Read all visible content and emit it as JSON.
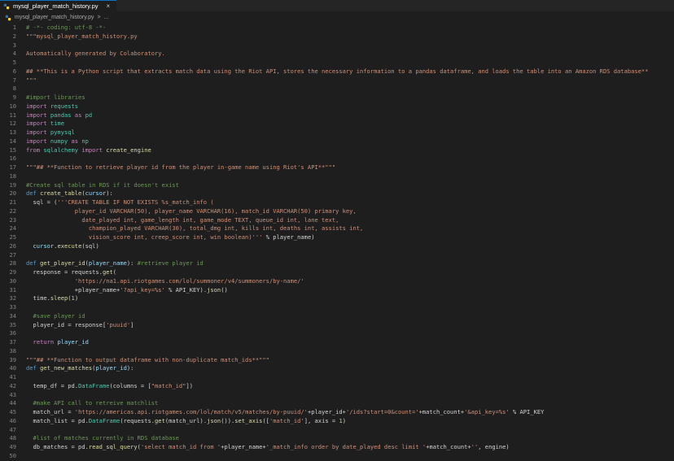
{
  "tab": {
    "title": "mysql_player_match_history.py",
    "close": "×"
  },
  "breadcrumb": {
    "file": "mysql_player_match_history.py",
    "sep": ">",
    "more": "..."
  },
  "colors": {
    "comment": "#6a9955",
    "string": "#ce9178",
    "keyword": "#c586c0",
    "def": "#569cd6",
    "func": "#dcdcaa",
    "var": "#9cdcfe",
    "number": "#b5cea8"
  },
  "lines": [
    {
      "n": "1",
      "t": [
        [
          "# -*- coding: utf-8 -*-",
          "comment"
        ]
      ]
    },
    {
      "n": "2",
      "t": [
        [
          "\"\"\"mysql_player_match_history.py",
          "string"
        ]
      ]
    },
    {
      "n": "3",
      "t": []
    },
    {
      "n": "4",
      "t": [
        [
          "Automatically generated by Colaboratory.",
          "string"
        ]
      ]
    },
    {
      "n": "5",
      "t": []
    },
    {
      "n": "6",
      "t": [
        [
          "## **This is a Python script that extracts match data using the Riot API, stores the necessary information to a pandas dataframe, and loads the table into an Amazon RDS database**",
          "string"
        ]
      ]
    },
    {
      "n": "7",
      "t": [
        [
          "\"\"\"",
          "string"
        ]
      ]
    },
    {
      "n": "8",
      "t": []
    },
    {
      "n": "9",
      "t": [
        [
          "#import libraries",
          "comment"
        ]
      ]
    },
    {
      "n": "10",
      "t": [
        [
          "import",
          "keyword"
        ],
        [
          " requests",
          "class"
        ]
      ]
    },
    {
      "n": "11",
      "t": [
        [
          "import",
          "keyword"
        ],
        [
          " pandas ",
          "class"
        ],
        [
          "as",
          "keyword"
        ],
        [
          " pd",
          "class"
        ]
      ]
    },
    {
      "n": "12",
      "t": [
        [
          "import",
          "keyword"
        ],
        [
          " time",
          "class"
        ]
      ]
    },
    {
      "n": "13",
      "t": [
        [
          "import",
          "keyword"
        ],
        [
          " pymysql",
          "class"
        ]
      ]
    },
    {
      "n": "14",
      "t": [
        [
          "import",
          "keyword"
        ],
        [
          " numpy ",
          "class"
        ],
        [
          "as",
          "keyword"
        ],
        [
          " np",
          "class"
        ]
      ]
    },
    {
      "n": "15",
      "t": [
        [
          "from",
          "keyword"
        ],
        [
          " sqlalchemy ",
          "class"
        ],
        [
          "import",
          "keyword"
        ],
        [
          " create_engine",
          "func"
        ]
      ]
    },
    {
      "n": "16",
      "t": []
    },
    {
      "n": "17",
      "t": [
        [
          "\"\"\"## **Function to retrieve player id from the player in-game name using Riot's API**\"\"\"",
          "string"
        ]
      ]
    },
    {
      "n": "18",
      "t": []
    },
    {
      "n": "19",
      "t": [
        [
          "#Create sql table in RDS if it doesn't exist",
          "comment"
        ]
      ]
    },
    {
      "n": "20",
      "t": [
        [
          "def",
          "def"
        ],
        [
          " create_table",
          "func"
        ],
        [
          "(",
          "plain"
        ],
        [
          "cursor",
          "var"
        ],
        [
          "):",
          "plain"
        ]
      ]
    },
    {
      "n": "21",
      "t": [
        [
          "  sql = (",
          "plain"
        ],
        [
          "'''CREATE TABLE IF NOT EXISTS %s_match_info (",
          "string"
        ]
      ]
    },
    {
      "n": "22",
      "t": [
        [
          "              player_id VARCHAR(50), player_name VARCHAR(16), match_id VARCHAR(50) primary key,",
          "string"
        ]
      ]
    },
    {
      "n": "23",
      "t": [
        [
          "                date_played int, game_length int, game_mode TEXT, queue_id int, lane text,",
          "string"
        ]
      ]
    },
    {
      "n": "24",
      "t": [
        [
          "                  champion_played VARCHAR(30), total_dmg int, kills int, deaths int, assists int,",
          "string"
        ]
      ]
    },
    {
      "n": "25",
      "t": [
        [
          "                  vision_score int, creep_score int, win boolean)'''",
          "string"
        ],
        [
          " % player_name)",
          "plain"
        ]
      ]
    },
    {
      "n": "26",
      "t": [
        [
          "  cursor",
          "var"
        ],
        [
          ".",
          "plain"
        ],
        [
          "execute",
          "func"
        ],
        [
          "(sql)",
          "plain"
        ]
      ]
    },
    {
      "n": "27",
      "t": []
    },
    {
      "n": "28",
      "t": [
        [
          "def",
          "def"
        ],
        [
          " get_player_id",
          "func"
        ],
        [
          "(",
          "plain"
        ],
        [
          "player_name",
          "var"
        ],
        [
          "): ",
          "plain"
        ],
        [
          "#retrieve player id",
          "comment"
        ]
      ]
    },
    {
      "n": "29",
      "t": [
        [
          "  response = requests.",
          "plain"
        ],
        [
          "get",
          "func"
        ],
        [
          "(",
          "plain"
        ]
      ]
    },
    {
      "n": "30",
      "t": [
        [
          "              'https://na1.api.riotgames.com/lol/summoner/v4/summoners/by-name/'",
          "string"
        ]
      ]
    },
    {
      "n": "31",
      "t": [
        [
          "              +player_name+",
          "plain"
        ],
        [
          "'?api_key=%s'",
          "string"
        ],
        [
          " % API_KEY).",
          "plain"
        ],
        [
          "json",
          "func"
        ],
        [
          "()",
          "plain"
        ]
      ]
    },
    {
      "n": "32",
      "t": [
        [
          "  time.",
          "plain"
        ],
        [
          "sleep",
          "func"
        ],
        [
          "(",
          "plain"
        ],
        [
          "1",
          "number"
        ],
        [
          ")",
          "plain"
        ]
      ]
    },
    {
      "n": "33",
      "t": []
    },
    {
      "n": "34",
      "t": [
        [
          "  #save player id",
          "comment"
        ]
      ]
    },
    {
      "n": "35",
      "t": [
        [
          "  player_id = response[",
          "plain"
        ],
        [
          "'puuid'",
          "string"
        ],
        [
          "]",
          "plain"
        ]
      ]
    },
    {
      "n": "36",
      "t": []
    },
    {
      "n": "37",
      "t": [
        [
          "  ",
          "plain"
        ],
        [
          "return",
          "keyword"
        ],
        [
          " player_id",
          "var"
        ]
      ]
    },
    {
      "n": "38",
      "t": []
    },
    {
      "n": "39",
      "t": [
        [
          "\"\"\"## **Function to output dataframe with non-duplicate match_ids**\"\"\"",
          "string"
        ]
      ]
    },
    {
      "n": "40",
      "t": [
        [
          "def",
          "def"
        ],
        [
          " get_new_matches",
          "func"
        ],
        [
          "(",
          "plain"
        ],
        [
          "player_id",
          "var"
        ],
        [
          "):",
          "plain"
        ]
      ]
    },
    {
      "n": "41",
      "t": []
    },
    {
      "n": "42",
      "t": [
        [
          "  temp_df = pd.",
          "plain"
        ],
        [
          "DataFrame",
          "class"
        ],
        [
          "(columns = [",
          "plain"
        ],
        [
          "\"match_id\"",
          "string"
        ],
        [
          "])",
          "plain"
        ]
      ]
    },
    {
      "n": "43",
      "t": []
    },
    {
      "n": "44",
      "t": [
        [
          "  #make API call to retreive matchlist",
          "comment"
        ]
      ]
    },
    {
      "n": "45",
      "t": [
        [
          "  match_url = ",
          "plain"
        ],
        [
          "'https://americas.api.riotgames.com/lol/match/v5/matches/by-puuid/'",
          "string"
        ],
        [
          "+player_id+",
          "plain"
        ],
        [
          "'/ids?start=0&count='",
          "string"
        ],
        [
          "+match_count+",
          "plain"
        ],
        [
          "'&api_key=%s'",
          "string"
        ],
        [
          " % API_KEY",
          "plain"
        ]
      ]
    },
    {
      "n": "46",
      "t": [
        [
          "  match_list = pd.",
          "plain"
        ],
        [
          "DataFrame",
          "class"
        ],
        [
          "(requests.",
          "plain"
        ],
        [
          "get",
          "func"
        ],
        [
          "(match_url).",
          "plain"
        ],
        [
          "json",
          "func"
        ],
        [
          "()).",
          "plain"
        ],
        [
          "set_axis",
          "func"
        ],
        [
          "([",
          "plain"
        ],
        [
          "'match_id'",
          "string"
        ],
        [
          "], axis = ",
          "plain"
        ],
        [
          "1",
          "number"
        ],
        [
          ")",
          "plain"
        ]
      ]
    },
    {
      "n": "47",
      "t": []
    },
    {
      "n": "48",
      "t": [
        [
          "  #list of matches currently in RDS database",
          "comment"
        ]
      ]
    },
    {
      "n": "49",
      "t": [
        [
          "  db_matches = pd.",
          "plain"
        ],
        [
          "read_sql_query",
          "func"
        ],
        [
          "(",
          "plain"
        ],
        [
          "'select match_id from '",
          "string"
        ],
        [
          "+player_name+",
          "plain"
        ],
        [
          "'_match_info order by date_played desc limit '",
          "string"
        ],
        [
          "+match_count+",
          "plain"
        ],
        [
          "''",
          "string"
        ],
        [
          ", engine)",
          "plain"
        ]
      ]
    },
    {
      "n": "50",
      "t": []
    }
  ]
}
